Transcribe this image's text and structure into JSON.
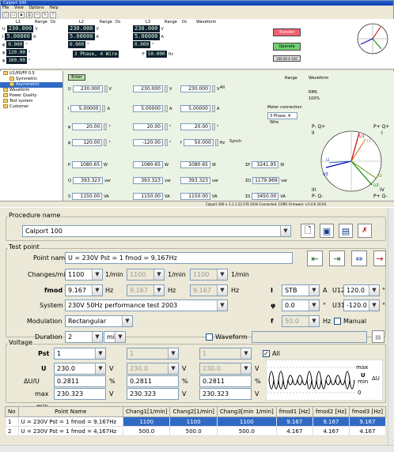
{
  "top_window": {
    "title": "Calport 100",
    "menu": [
      "File",
      "View",
      "Options",
      "Help"
    ],
    "meter": {
      "phases": [
        {
          "name": "L1",
          "range_label": "Range",
          "dc_label": "Dc",
          "u": "230.000",
          "i": "5.00000",
          "phi": "0.000",
          "f": "120.00",
          "uf": "100.00"
        },
        {
          "name": "L2",
          "range_label": "Range",
          "dc_label": "Dc",
          "u": "230.000",
          "i": "5.00000",
          "phi": "0.000",
          "f": "120.00"
        },
        {
          "name": "L3",
          "range_label": "Range",
          "dc_label": "Dc",
          "u": "230.000",
          "i": "5.00000",
          "phi": "0.000",
          "f": "120.00"
        }
      ],
      "waveform_label": "Waveform",
      "mode_value": "3 Phase, 4 Wire",
      "freq_value": "50.000",
      "transfer_label": "Transfer",
      "operate_label": "Operate",
      "gray_btn_label": "100.00 A 100"
    },
    "tree": [
      "U1/P0/FP 0.5",
      "Symmetric",
      "Asymmetric",
      "Waveform",
      "Power Quality",
      "Test system",
      "Customer"
    ],
    "main": {
      "enter_label": "Enter",
      "u_row": [
        "230.000",
        "230.000",
        "230.000"
      ],
      "i_row": [
        "5.00000",
        "5.00000",
        "5.00000"
      ],
      "phi_row": [
        "20.00",
        "20.00",
        "20.00"
      ],
      "cos_row": [
        "120.00",
        "-120.00",
        "50.000"
      ],
      "p_row": [
        "1080.65",
        "1080.65",
        "1080.65"
      ],
      "q_row": [
        "393.323",
        "393.323",
        "393.323"
      ],
      "s_row": [
        "1150.00",
        "1150.00",
        "1150.00"
      ],
      "sum_p": "3241.95",
      "sum_q": "1179.969",
      "sum_s": "3450.00",
      "all_label": "All",
      "sync_label": "Synch",
      "range_label": "Range",
      "waveform_label": "Waveform",
      "rms_label": "RMS",
      "unbal_label": "100%",
      "meter_conn_label": "Meter connection",
      "meter_conn_value": "3 Phase, 4 Wire",
      "quadrant_labels": [
        "P- Q+",
        "P+ Q+",
        "II",
        "I",
        "III",
        "IV",
        "P- Q-",
        "P+ Q-"
      ],
      "phasor_labels": [
        "U1",
        "U2",
        "U3",
        "I1",
        "I2",
        "I3"
      ],
      "status": "Calport 300 v. 1.1.1.22   576 1016   Connected: COM1   Firmware: v.5.0.6   16:04"
    }
  },
  "procedure": {
    "group_label": "Procedure name",
    "name": "Calport 100"
  },
  "test_point": {
    "group_label": "Test point",
    "point_name_label": "Point name",
    "point_name": "U = 230V Pst = 1 fmod = 9,167Hz",
    "changes_label": "Changes/min",
    "changes": [
      "1100",
      "1100",
      "1100"
    ],
    "changes_unit": "1/min",
    "fmod_label": "fmod",
    "fmod": [
      "9.167",
      "9.167",
      "9.167"
    ],
    "hz": "Hz",
    "system_label": "System",
    "system_value": "230V 50Hz performance test 2003",
    "modulation_label": "Modulation",
    "modulation_value": "Rectangular",
    "duration_label": "Duration",
    "duration_value": "2",
    "duration_unit": "min",
    "waveform_label": "Waveform",
    "i_label": "I",
    "i_value": "STB",
    "i_unit": "A",
    "phi_label": "φ",
    "phi_value": "0.0",
    "deg": "°",
    "f_label": "f",
    "f_value": "50.0",
    "manual_label": "Manual",
    "u12_label": "U12",
    "u12_value": "120.0",
    "u31_label": "U31",
    "u31_value": "-120.0"
  },
  "voltage": {
    "group_label": "Voltage",
    "pst_label": "Pst",
    "pst": [
      "1",
      "1",
      "1"
    ],
    "all_label": "All",
    "u_label": "U",
    "u": [
      "230.0",
      "230.0",
      "230.0"
    ],
    "u_unit": "V",
    "du_label": "ΔU/U",
    "du": [
      "0.2811",
      "0.2811",
      "0.2811"
    ],
    "pct": "%",
    "max_label": "max",
    "max": [
      "230.323",
      "230.323",
      "230.323"
    ],
    "min_label": "min",
    "min": [
      "229.677",
      "229.677",
      "229.677"
    ],
    "wave_labels": {
      "max": "max",
      "u": "U",
      "min": "min",
      "du": "ΔU",
      "zero": "0"
    }
  },
  "table": {
    "headers": [
      "No",
      "Point Name",
      "Chang1[1/min]",
      "Chang2[1/min]",
      "Chang3[min 1/min]",
      "fmod1 [Hz]",
      "fmod2 [Hz]",
      "fmod3 [Hz]"
    ],
    "rows": [
      [
        "1",
        "U = 230V Pst = 1 fmod = 9,167Hz",
        "1100",
        "1100",
        "1100",
        "9.167",
        "9.167",
        "9.167"
      ],
      [
        "2",
        "U = 230V Pst = 1 fmod = 4,167Hz",
        "500.0",
        "500.0",
        "500.0",
        "4.167",
        "4.167",
        "4.167"
      ]
    ]
  }
}
